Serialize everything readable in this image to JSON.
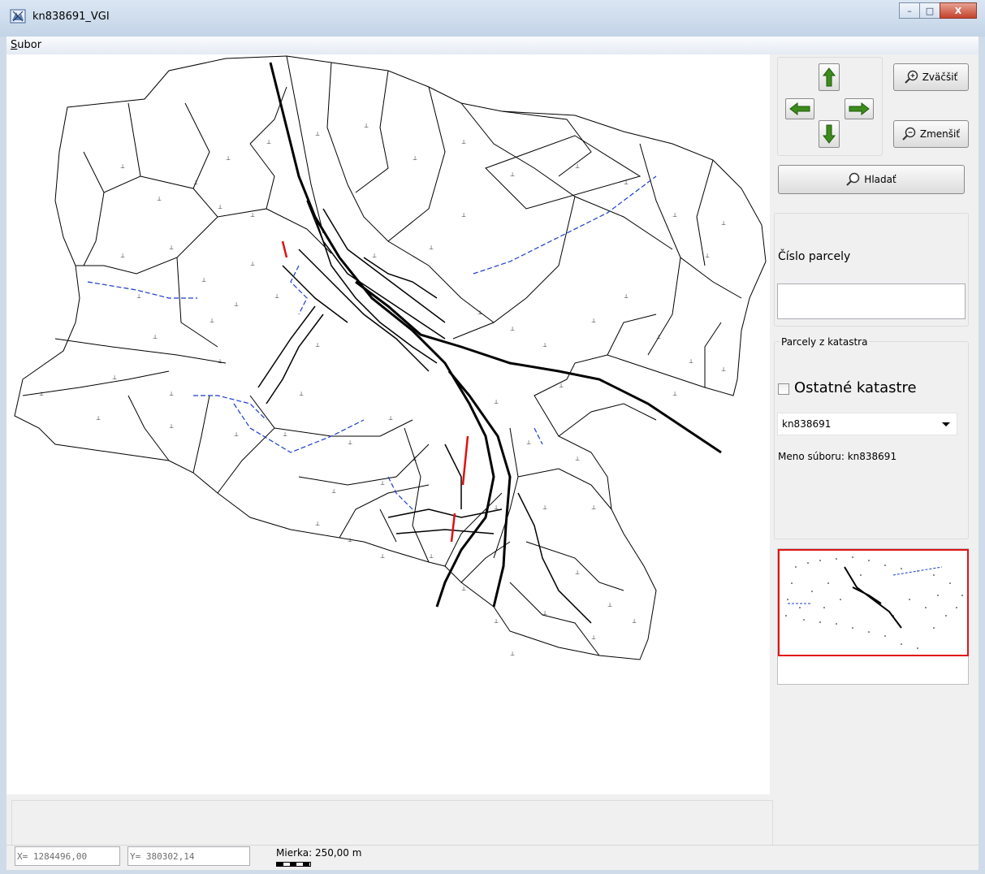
{
  "window": {
    "title": "kn838691_VGI",
    "minimize_glyph": "–",
    "maximize_glyph": "□",
    "close_glyph": "X"
  },
  "menu": {
    "file_accel": "S",
    "file_rest": "ubor"
  },
  "nav": {
    "zoom_in_label": "Zväčšiť",
    "zoom_out_label": "Zmenšiť",
    "search_label": "Hladať"
  },
  "parcel": {
    "label": "Číslo parcely",
    "value": ""
  },
  "cadastre": {
    "group_title": "Parcely z katastra",
    "other_label": "Ostatné katastre",
    "other_checked": false,
    "selected": "kn838691",
    "file_name_label": "Meno súboru: kn838691"
  },
  "status": {
    "x": "X= 1284496,00",
    "y": "Y= 380302,14",
    "scale": "Mierka: 250,00 m"
  },
  "colors": {
    "arrow_green": "#3c8c1c",
    "overview_border": "#e01515",
    "map_line": "#000000",
    "river_blue": "#1a3ccc",
    "road_red": "#e01010"
  },
  "icons": {
    "zoom_in": "magnifier-plus-icon",
    "zoom_out": "magnifier-minus-icon",
    "search": "magnifier-icon",
    "arrows": [
      "arrow-up-icon",
      "arrow-left-icon",
      "arrow-right-icon",
      "arrow-down-icon"
    ]
  }
}
